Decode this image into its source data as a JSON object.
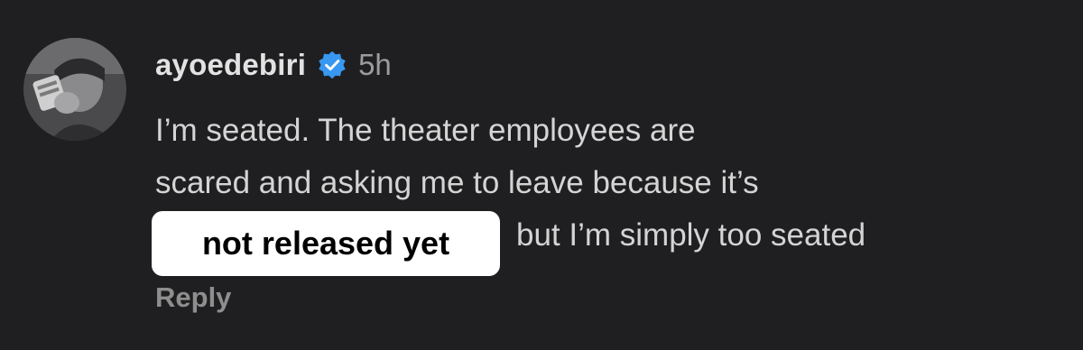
{
  "comment": {
    "username": "ayoedebiri",
    "verified": true,
    "time": "5h",
    "lines": [
      "I’m seated. The theater employees are",
      "scared and asking me to leave because it’s",
      "but I’m simply too seated"
    ],
    "highlight": "not released yet",
    "reply_label": "Reply"
  },
  "colors": {
    "background": "#1f1f21",
    "username": "#e2e2e2",
    "text": "#d4d4d4",
    "muted": "#9c9c9c",
    "verified_badge": "#3897f0",
    "highlight_bg": "#ffffff",
    "highlight_text": "#000000"
  },
  "icons": {
    "verified": "verified-badge-icon"
  }
}
